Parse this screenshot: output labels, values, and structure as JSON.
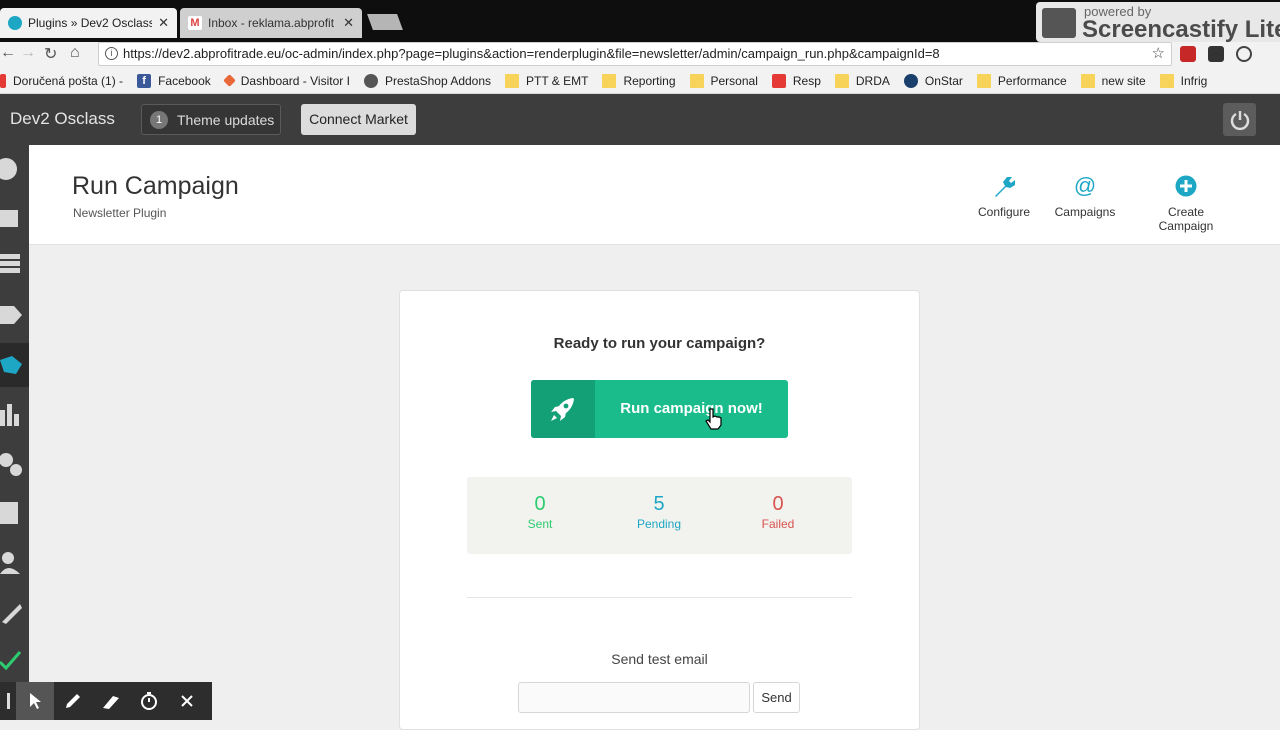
{
  "browser": {
    "tabs": [
      {
        "title": "Plugins » Dev2 Osclass",
        "active": true
      },
      {
        "title": "Inbox - reklama.abprofit",
        "active": false
      }
    ],
    "url": "https://dev2.abprofitrade.eu/oc-admin/index.php?page=plugins&action=renderplugin&file=newsletter/admin/campaign_run.php&campaignId=8",
    "bookmarks": [
      {
        "label": "Doručená pošta (1) -",
        "icon": "mail-icon"
      },
      {
        "label": "Facebook",
        "icon": "facebook-icon"
      },
      {
        "label": "Dashboard - Visitor I",
        "icon": "dashboard-icon"
      },
      {
        "label": "PrestaShop Addons",
        "icon": "prestashop-icon"
      },
      {
        "label": "PTT & EMT",
        "icon": "folder-icon"
      },
      {
        "label": "Reporting",
        "icon": "folder-icon"
      },
      {
        "label": "Personal",
        "icon": "folder-icon"
      },
      {
        "label": "Resp",
        "icon": "resp-icon"
      },
      {
        "label": "DRDA",
        "icon": "folder-icon"
      },
      {
        "label": "OnStar",
        "icon": "onstar-icon"
      },
      {
        "label": "Performance",
        "icon": "folder-icon"
      },
      {
        "label": "new site",
        "icon": "folder-icon"
      },
      {
        "label": "Infrig",
        "icon": "folder-icon"
      }
    ]
  },
  "watermark": {
    "small": "powered by",
    "big": "Screencastify Lite"
  },
  "header": {
    "brand": "Dev2 Osclass",
    "theme_badge": "1",
    "theme_label": "Theme updates",
    "market_label": "Connect Market"
  },
  "page": {
    "title": "Run Campaign",
    "subtitle": "Newsletter Plugin",
    "actions": [
      {
        "label": "Configure",
        "icon": "wrench-icon"
      },
      {
        "label": "Campaigns",
        "icon": "at-icon"
      },
      {
        "label": "Create Campaign",
        "icon": "plus-circle-icon"
      }
    ]
  },
  "campaign": {
    "ready_text": "Ready to run your campaign?",
    "run_label": "Run campaign now!",
    "stats": [
      {
        "value": "0",
        "label": "Sent",
        "color": "#2ecc71"
      },
      {
        "value": "5",
        "label": "Pending",
        "color": "#1ea7c5"
      },
      {
        "value": "0",
        "label": "Failed",
        "color": "#d9534f"
      }
    ],
    "test_title": "Send test email",
    "test_placeholder": "",
    "send_label": "Send"
  },
  "colors": {
    "accent": "#1abc8c",
    "accent_dark": "#14a077",
    "link_blue": "#1ea7c5"
  }
}
